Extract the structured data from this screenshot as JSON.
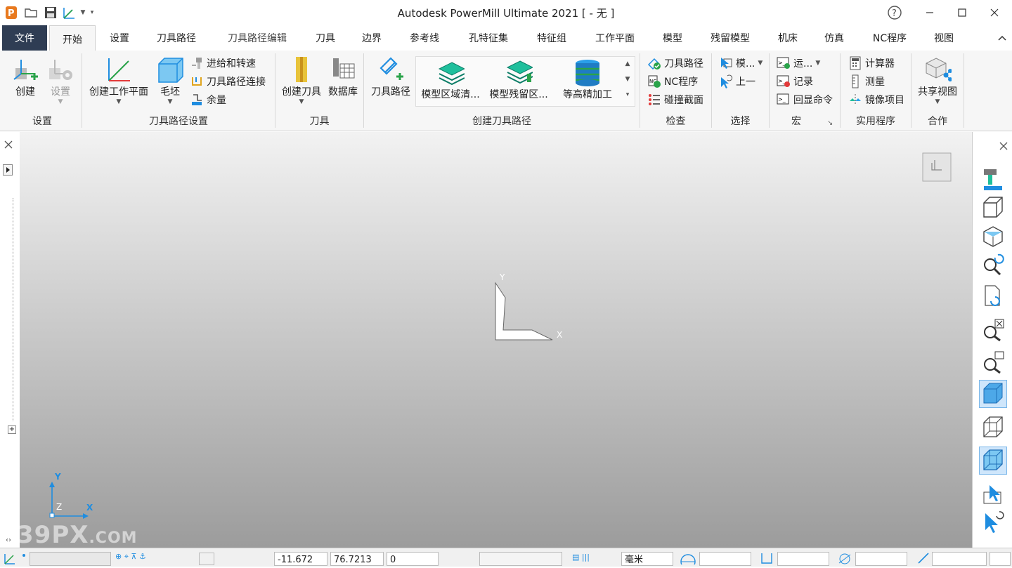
{
  "app": {
    "title": "Autodesk PowerMill Ultimate 2021     [  - 无 ]"
  },
  "tabs": [
    "文件",
    "开始",
    "设置",
    "刀具路径",
    "刀具路径编辑",
    "刀具",
    "边界",
    "参考线",
    "孔特征集",
    "特征组",
    "工作平面",
    "模型",
    "残留模型",
    "机床",
    "仿真",
    "NC程序",
    "视图"
  ],
  "ribbon": {
    "settings": {
      "create": "创建",
      "settings": "设置",
      "group": "设置"
    },
    "toolpath_setup": {
      "create_wp": "创建工作平面",
      "block": "毛坯",
      "feeds": "进给和转速",
      "connections": "刀具路径连接",
      "allowance": "余量",
      "group": "刀具路径设置"
    },
    "tool": {
      "create_tool": "创建刀具",
      "database": "数据库",
      "group": "刀具"
    },
    "create_toolpath": {
      "toolpath": "刀具路径",
      "g1": "模型区域清...",
      "g2": "模型残留区...",
      "g3": "等高精加工",
      "group": "创建刀具路径"
    },
    "inspect": {
      "toolpath": "刀具路径",
      "nc": "NC程序",
      "collision": "碰撞截面",
      "group": "检查"
    },
    "select": {
      "model": "模...",
      "prev": "上一",
      "group": "选择"
    },
    "macro": {
      "run": "运...",
      "record": "记录",
      "echo": "回显命令",
      "group": "宏"
    },
    "utilities": {
      "calc": "计算器",
      "measure": "测量",
      "mirror": "镜像项目",
      "group": "实用程序"
    },
    "collab": {
      "share": "共享视图",
      "group": "合作"
    }
  },
  "viewport": {
    "axis_y": "Y",
    "axis_x": "X",
    "mini_y": "Y",
    "mini_x": "X",
    "mini_z": "Z"
  },
  "statusbar": {
    "x": "-11.672",
    "y": "76.7213",
    "z": "0",
    "units": "毫米"
  },
  "watermark": {
    "main": "39PX",
    "suffix": ".COM"
  }
}
